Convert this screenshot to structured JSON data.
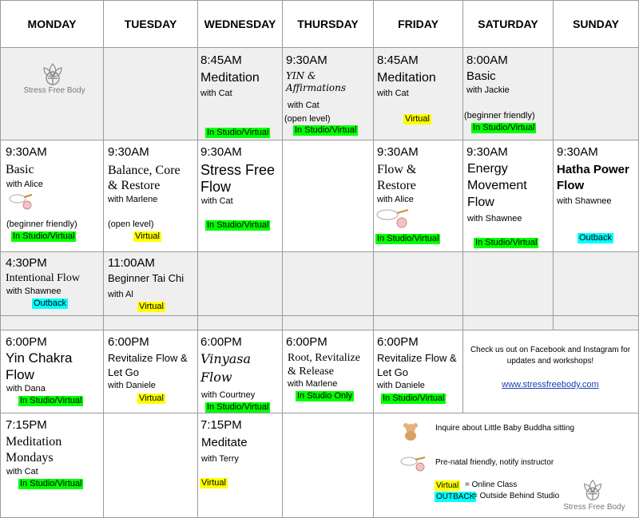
{
  "days": [
    "MONDAY",
    "TUESDAY",
    "WEDNESDAY",
    "THURSDAY",
    "FRIDAY",
    "SATURDAY",
    "SUNDAY"
  ],
  "logo_text": "Stress Free Body",
  "tags": {
    "studio_virtual": "In Studio/Virtual",
    "virtual": "Virtual",
    "outback": "Outback",
    "studio_only": "In Studio Only"
  },
  "r1": {
    "wed": {
      "time": "8:45AM",
      "title": "Meditation",
      "with": "with Cat"
    },
    "thu": {
      "time": "9:30AM",
      "title": "YIN & Affirmations",
      "with": "with Cat",
      "note": "(open level)"
    },
    "fri": {
      "time": "8:45AM",
      "title": "Meditation",
      "with": "with Cat"
    },
    "sat": {
      "time": "8:00AM",
      "title": "Basic",
      "with": "with Jackie",
      "note": "(beginner friendly)"
    }
  },
  "r2": {
    "mon": {
      "time": "9:30AM",
      "title": "Basic",
      "with": "with Alice",
      "note": "(beginner friendly)"
    },
    "tue": {
      "time": "9:30AM",
      "title1": "Balance, Core",
      "title2": "& Restore",
      "with": "with Marlene",
      "note": "(open level)"
    },
    "wed": {
      "time": "9:30AM",
      "title1": "Stress Free",
      "title2": "Flow",
      "with": "with Cat"
    },
    "fri": {
      "time": "9:30AM",
      "title1": "Flow &",
      "title2": "Restore",
      "with": "with Alice"
    },
    "sat": {
      "time": "9:30AM",
      "title1": "Energy",
      "title2": "Movement",
      "title3": "Flow",
      "with": "with  Shawnee"
    },
    "sun": {
      "time": "9:30AM",
      "title1": "Hatha Power",
      "title2": "Flow",
      "with": "with  Shawnee"
    }
  },
  "r3": {
    "mon": {
      "time": "4:30PM",
      "title": "Intentional Flow",
      "with": "with Shawnee"
    },
    "tue": {
      "time": "11:00AM",
      "title": "Beginner Tai Chi",
      "with": "with Al"
    }
  },
  "r4": {
    "mon": {
      "time": "6:00PM",
      "title1": "Yin Chakra",
      "title2": "Flow",
      "with": "with Dana"
    },
    "tue": {
      "time": "6:00PM",
      "title1": "Revitalize Flow &",
      "title2": "Let Go",
      "with": "with Daniele"
    },
    "wed": {
      "time": "6:00PM",
      "title1": "Vinyasa",
      "title2": "Flow",
      "with": "with Courtney"
    },
    "thu": {
      "time": "6:00PM",
      "title1": "Root, Revitalize",
      "title2": "& Release",
      "with": "with Marlene"
    },
    "fri": {
      "time": "6:00PM",
      "title1": "Revitalize Flow &",
      "title2": "Let Go",
      "with": "with Daniele"
    },
    "promo1": "Check us out on Facebook and Instagram for",
    "promo2": "updates and workshops!",
    "website": "www.stressfreebody.com"
  },
  "r5": {
    "mon": {
      "time": "7:15PM",
      "title1": "Meditation",
      "title2": "Mondays",
      "with": "with Cat"
    },
    "wed": {
      "time": "7:15PM",
      "title": "Meditate",
      "with": "with Terry"
    }
  },
  "legend": {
    "baby": "Inquire about Little Baby Buddha sitting",
    "prenatal": "Pre-natal friendly,  notify instructor",
    "virtual_def": "=  Online Class",
    "virtual_word": "Virtual",
    "outback_word": "OUTBACK",
    "outback_def": "= Outside Behind Studio"
  },
  "colors": {
    "green": "#00ff00",
    "yellow": "#ffff00",
    "cyan": "#00ffff",
    "gray_row": "#efefef"
  },
  "icons": [
    "lotus-logo-icon",
    "stork-prenatal-icon",
    "teddy-bear-icon"
  ]
}
